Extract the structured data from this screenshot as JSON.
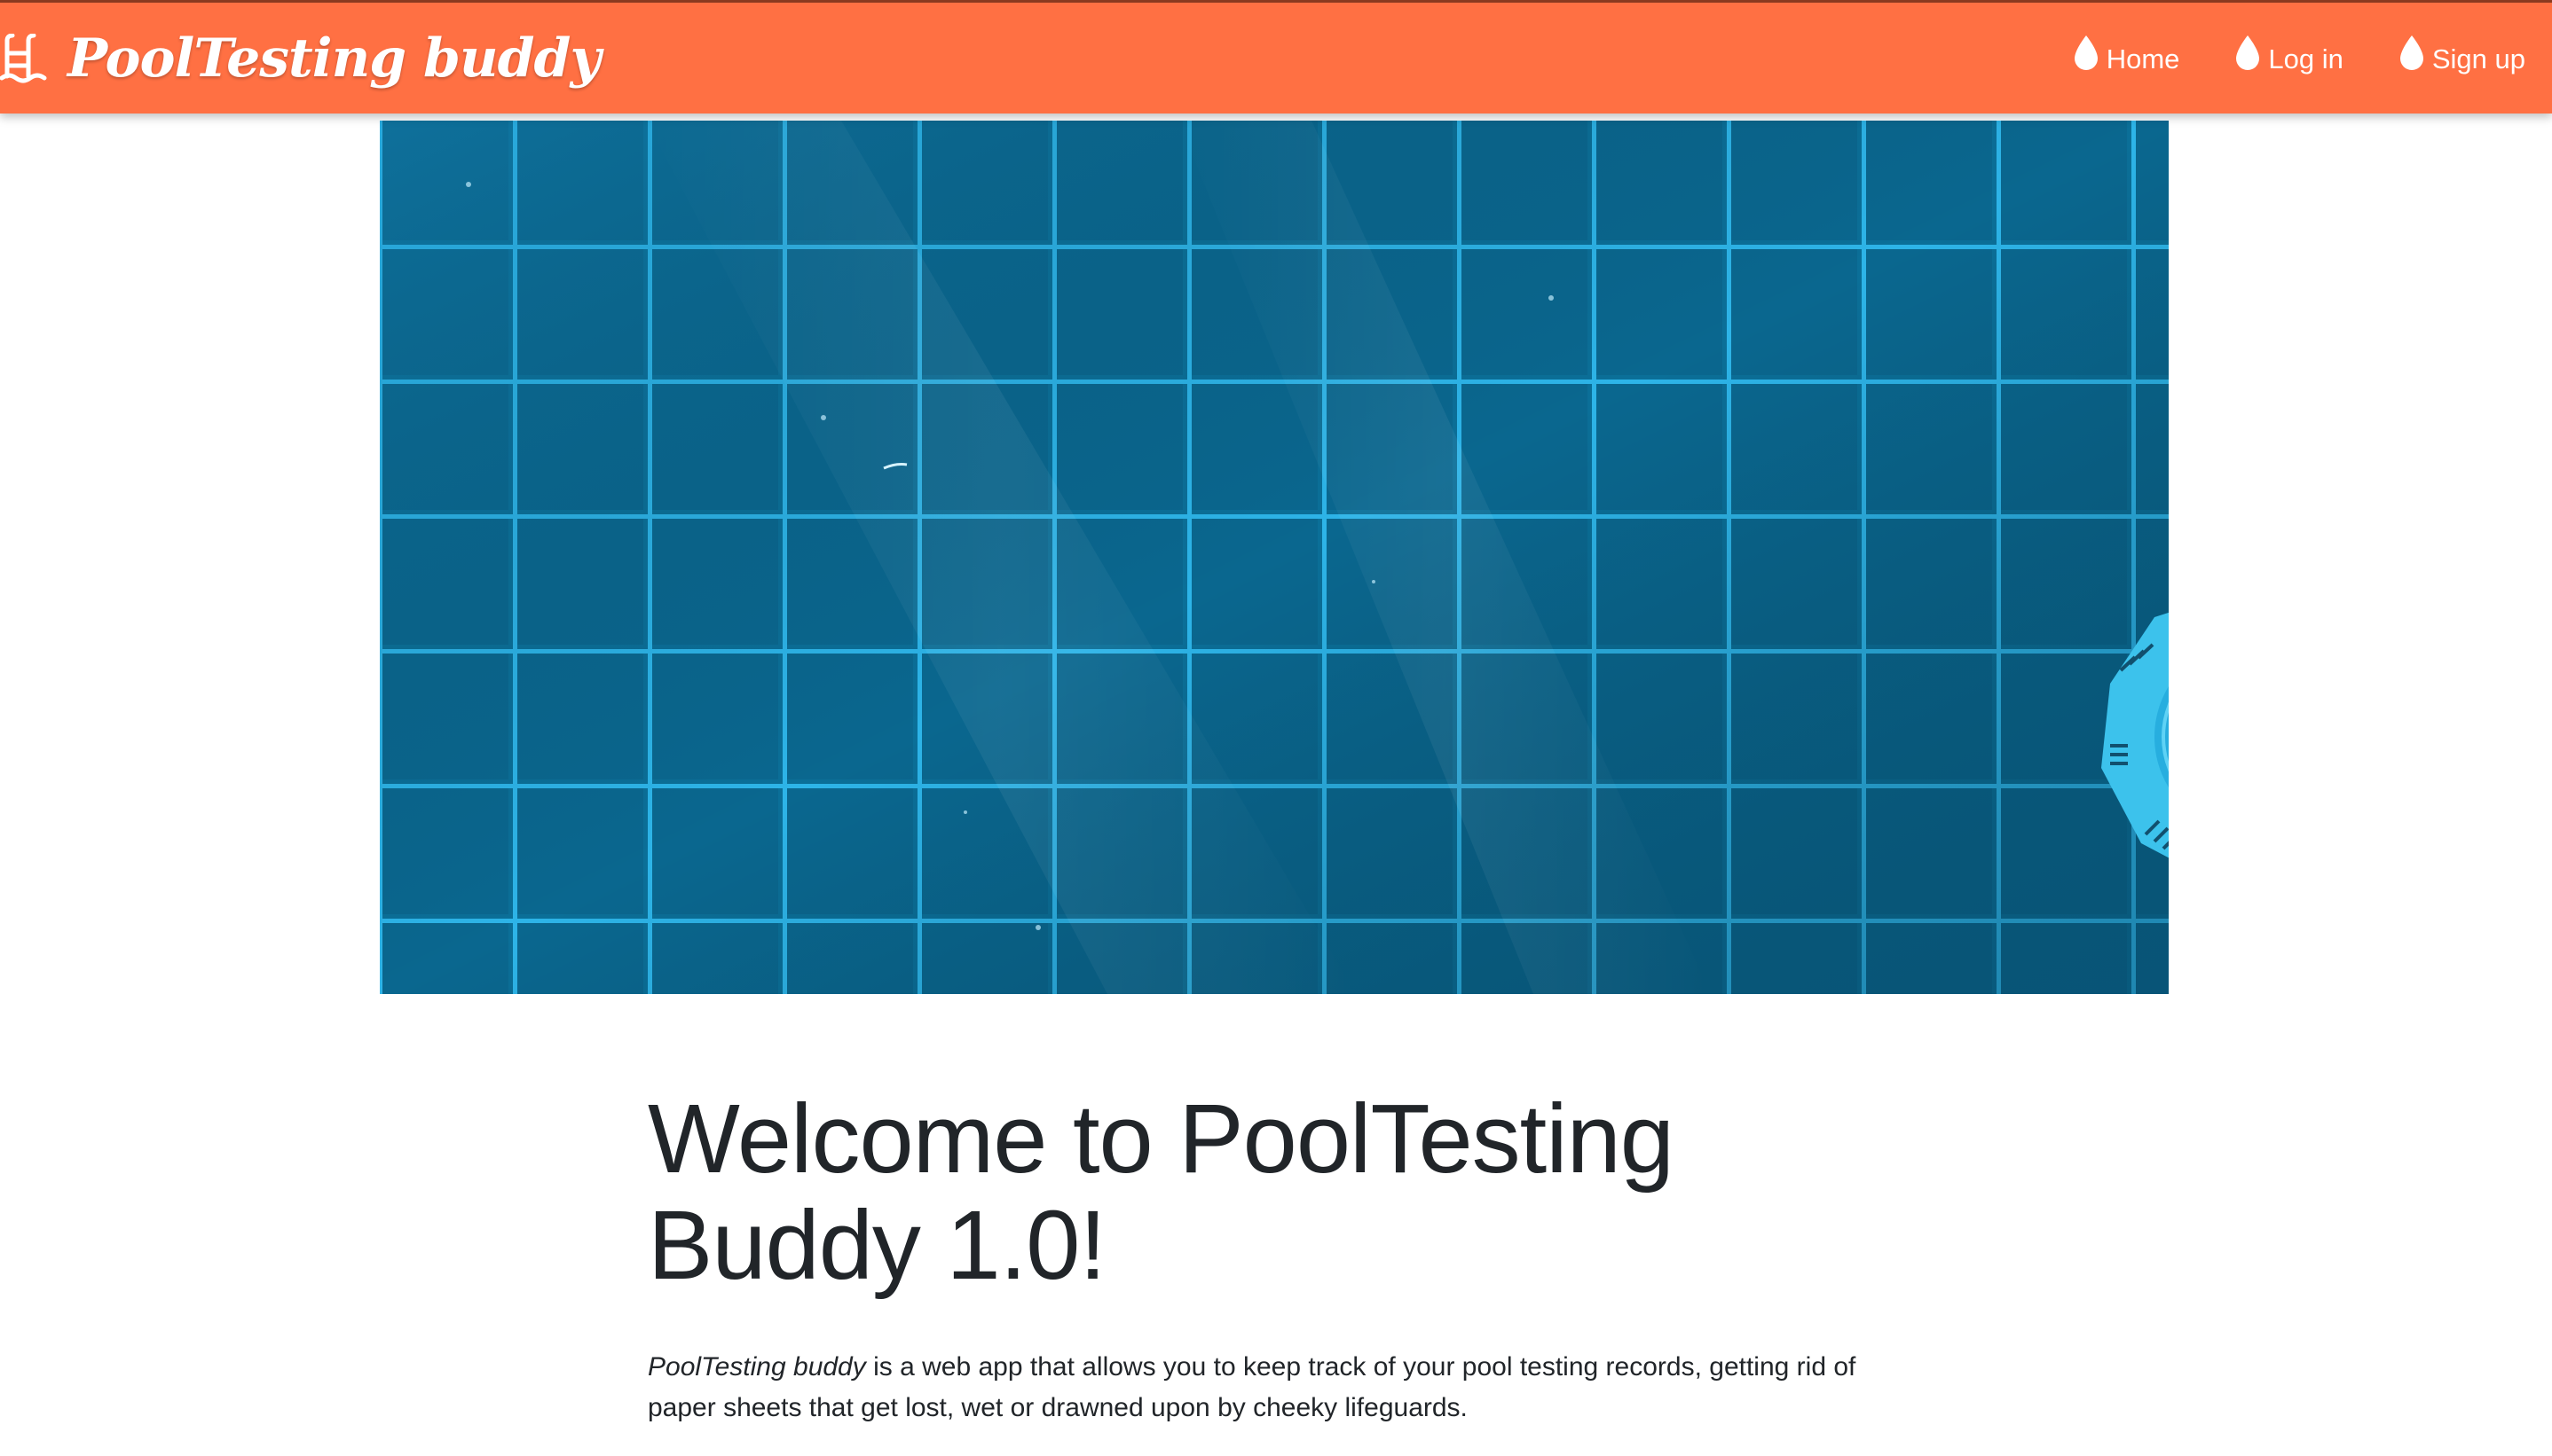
{
  "brand": {
    "name": "PoolTesting buddy",
    "icon": "pool-ladder-icon"
  },
  "nav": {
    "items": [
      {
        "label": "Home",
        "icon": "water-drop-icon"
      },
      {
        "label": "Log in",
        "icon": "water-drop-icon"
      },
      {
        "label": "Sign up",
        "icon": "water-drop-icon"
      }
    ]
  },
  "main": {
    "heading": "Welcome to PoolTesting Buddy 1.0!",
    "intro_app_name": "PoolTesting buddy",
    "intro_text": " is a web app that allows you to keep track of your pool testing records, getting rid of paper sheets that get lost, wet or drawned upon by cheeky lifeguards."
  },
  "colors": {
    "navbar": "#ff7043",
    "pool_water": "#0c6d96",
    "tile_grout": "#2fb6ea",
    "text": "#212529"
  }
}
